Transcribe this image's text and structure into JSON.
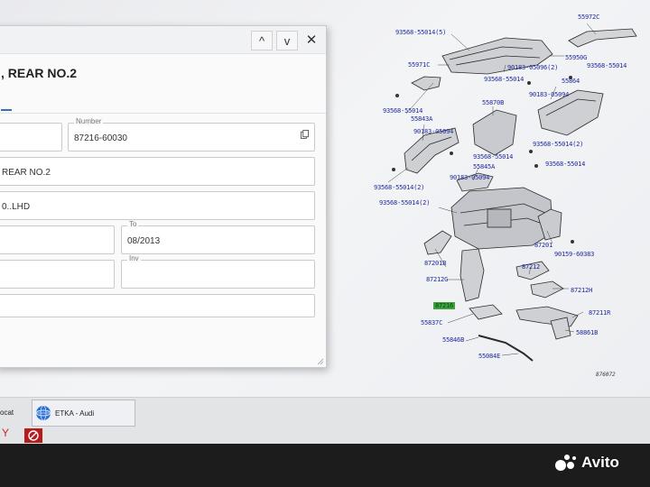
{
  "dialog": {
    "window_buttons": {
      "up": "^",
      "down": "v",
      "close": "✕"
    },
    "heading": ", REAR NO.2",
    "fields": {
      "row1_left_value": "",
      "number_label": "Number",
      "number_value": "87216-60030",
      "description_value": "REAR NO.2",
      "model_value": "0..LHD",
      "from_value": "",
      "to_label": "To",
      "to_value": "08/2013",
      "row4_left_value": "",
      "inv_label": "Inv",
      "inv_value": ""
    }
  },
  "diagram": {
    "labels": [
      {
        "id": "l1",
        "text": "93568-55014(5)"
      },
      {
        "id": "l2",
        "text": "55972C"
      },
      {
        "id": "l3",
        "text": "55971C"
      },
      {
        "id": "l4",
        "text": "55950G"
      },
      {
        "id": "l5",
        "text": "90183-05096(2)"
      },
      {
        "id": "l6",
        "text": "93568-55014"
      },
      {
        "id": "l7",
        "text": "93568-55014"
      },
      {
        "id": "l8",
        "text": "55864"
      },
      {
        "id": "l9",
        "text": "90183-05094"
      },
      {
        "id": "l10",
        "text": "93568-55014"
      },
      {
        "id": "l11",
        "text": "55870B"
      },
      {
        "id": "l12",
        "text": "55843A"
      },
      {
        "id": "l13",
        "text": "90183-05094"
      },
      {
        "id": "l14",
        "text": "93568-55014(2)"
      },
      {
        "id": "l15",
        "text": "93568-55014"
      },
      {
        "id": "l16",
        "text": "55845A"
      },
      {
        "id": "l17",
        "text": "93568-55014"
      },
      {
        "id": "l18",
        "text": "90183-05094"
      },
      {
        "id": "l19",
        "text": "93568-55014(2)"
      },
      {
        "id": "l20",
        "text": "93568-55014(2)"
      },
      {
        "id": "l21",
        "text": "87201"
      },
      {
        "id": "l22",
        "text": "90159-60383"
      },
      {
        "id": "l23",
        "text": "87201B"
      },
      {
        "id": "l24",
        "text": "87212"
      },
      {
        "id": "l25",
        "text": "87212G"
      },
      {
        "id": "l26",
        "text": "87212H"
      },
      {
        "id": "l27",
        "text": "87211R"
      },
      {
        "id": "l28",
        "text": "55837C"
      },
      {
        "id": "l29",
        "text": "58861B"
      },
      {
        "id": "l30",
        "text": "55846B"
      },
      {
        "id": "l31",
        "text": "55084E"
      },
      {
        "id": "l32",
        "text": "87216"
      }
    ],
    "figure_code": "876072"
  },
  "taskbar": {
    "item1_label": "ocat",
    "item2_label": "ETKA - Audi"
  },
  "watermark": {
    "text": "Avito"
  },
  "colors": {
    "label_blue": "#1f2a9a",
    "highlight_green": "#3aa53a"
  }
}
